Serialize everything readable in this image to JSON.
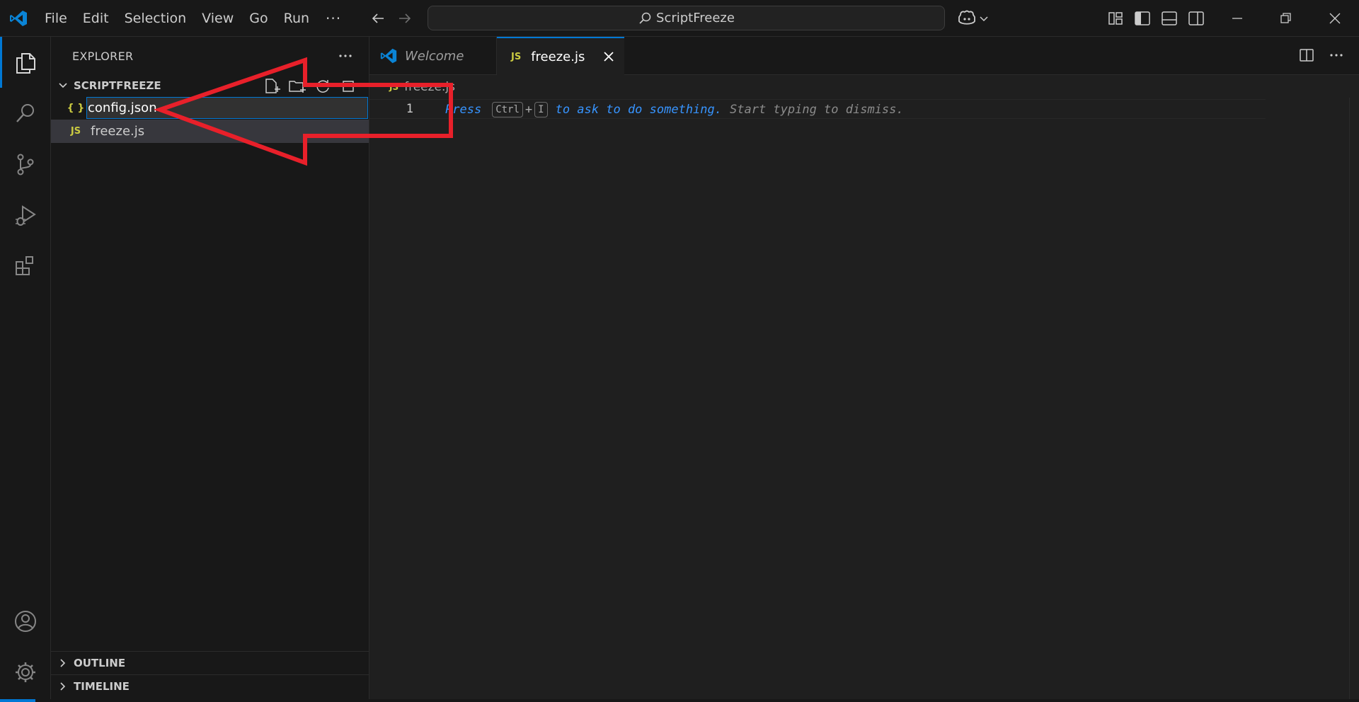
{
  "titlebar": {
    "menu": [
      "File",
      "Edit",
      "Selection",
      "View",
      "Go",
      "Run"
    ],
    "more": "···",
    "search_text": "ScriptFreeze"
  },
  "sidebar": {
    "title": "EXPLORER",
    "folder": "SCRIPTFREEZE",
    "files": [
      {
        "icon": "{ }",
        "name": "config.json",
        "state": "renaming"
      },
      {
        "icon": "JS",
        "name": "freeze.js",
        "state": "selected"
      }
    ],
    "outline": "OUTLINE",
    "timeline": "TIMELINE"
  },
  "editor": {
    "tabs": [
      {
        "label": "Welcome",
        "icon": "vscode-logo-icon"
      },
      {
        "label": "freeze.js",
        "icon": "JS"
      }
    ],
    "breadcrumb": {
      "icon": "JS",
      "file": "freeze.js"
    },
    "line_number": "1",
    "hint": {
      "press": "Press",
      "key1": "Ctrl",
      "plus": "+",
      "key2": "I",
      "ask": "to ask to do something.",
      "dismiss": "Start typing to dismiss."
    }
  },
  "colors": {
    "accent": "#0078d4",
    "annotation_arrow": "#e8202a",
    "js_icon": "#cbcb41"
  }
}
